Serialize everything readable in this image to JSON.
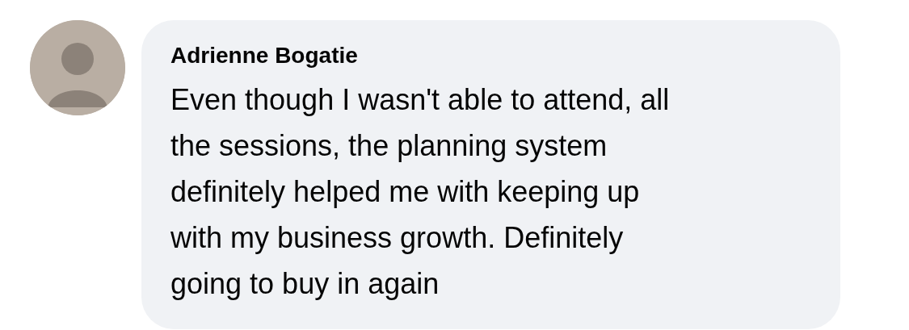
{
  "comment": {
    "author": "Adrienne Bogatie",
    "lines": [
      "Even though I wasn't able to attend, all",
      "the sessions, the planning system",
      "definitely helped me with keeping up",
      "with my business growth. Definitely",
      "going to buy in again"
    ]
  }
}
